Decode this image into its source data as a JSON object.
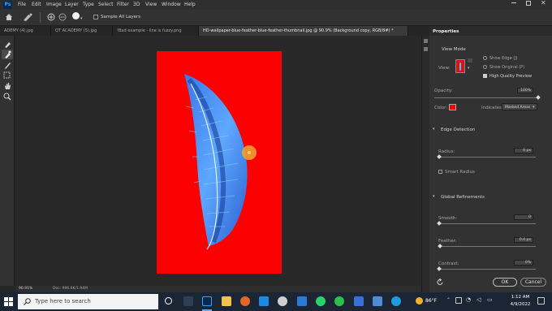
{
  "menu": {
    "logo": "Ps",
    "items": [
      "File",
      "Edit",
      "Image",
      "Layer",
      "Type",
      "Select",
      "Filter",
      "3D",
      "View",
      "Window",
      "Help"
    ]
  },
  "options": {
    "sample_all_layers": "Sample All Layers"
  },
  "tabs": [
    {
      "label": "ADEMY (4).jpg",
      "active": false
    },
    {
      "label": "QT ACADEMY (5).jpg",
      "active": false
    },
    {
      "label": "!Bad example - line is fuzzy.png",
      "active": false
    },
    {
      "label": "HD-wallpaper-blue-feather-blue-feather-thumbnail.jpg @ 90.9% (Background copy, RGB/8#) *",
      "active": true
    }
  ],
  "status": {
    "zoom": "90.91%",
    "doc": "Doc: 996.6K/1.94M"
  },
  "properties": {
    "title": "Properties",
    "view_mode_heading": "View Mode",
    "view_label": "View:",
    "show_edge": "Show Edge (J)",
    "show_original": "Show Original (P)",
    "high_quality_preview": "High Quality Preview",
    "opacity_label": "Opacity:",
    "opacity_value": "100%",
    "opacity_level": 1.0,
    "color_label": "Color:",
    "color_swatch": "#ff0000",
    "indicates_label": "Indicates:",
    "indicates_value": "Masked Areas",
    "edge_detection_heading": "Edge Detection",
    "radius_label": "Radius:",
    "radius_value": "0 px",
    "smart_radius": "Smart Radius",
    "global_refinements_heading": "Global Refinements",
    "smooth_label": "Smooth:",
    "smooth_value": "0",
    "feather_label": "Feather:",
    "feather_value": "0.4 px",
    "contrast_label": "Contrast:",
    "contrast_value": "0%",
    "ok_label": "OK",
    "cancel_label": "Cancel"
  },
  "taskbar": {
    "search_placeholder": "Type here to search",
    "weather": "86°F",
    "time": "1:12 AM",
    "date": "4/9/2022"
  },
  "colors": {
    "canvas_bg": "#fb0000",
    "feather": "#3e8cf0",
    "cursor": "#f0a030"
  }
}
